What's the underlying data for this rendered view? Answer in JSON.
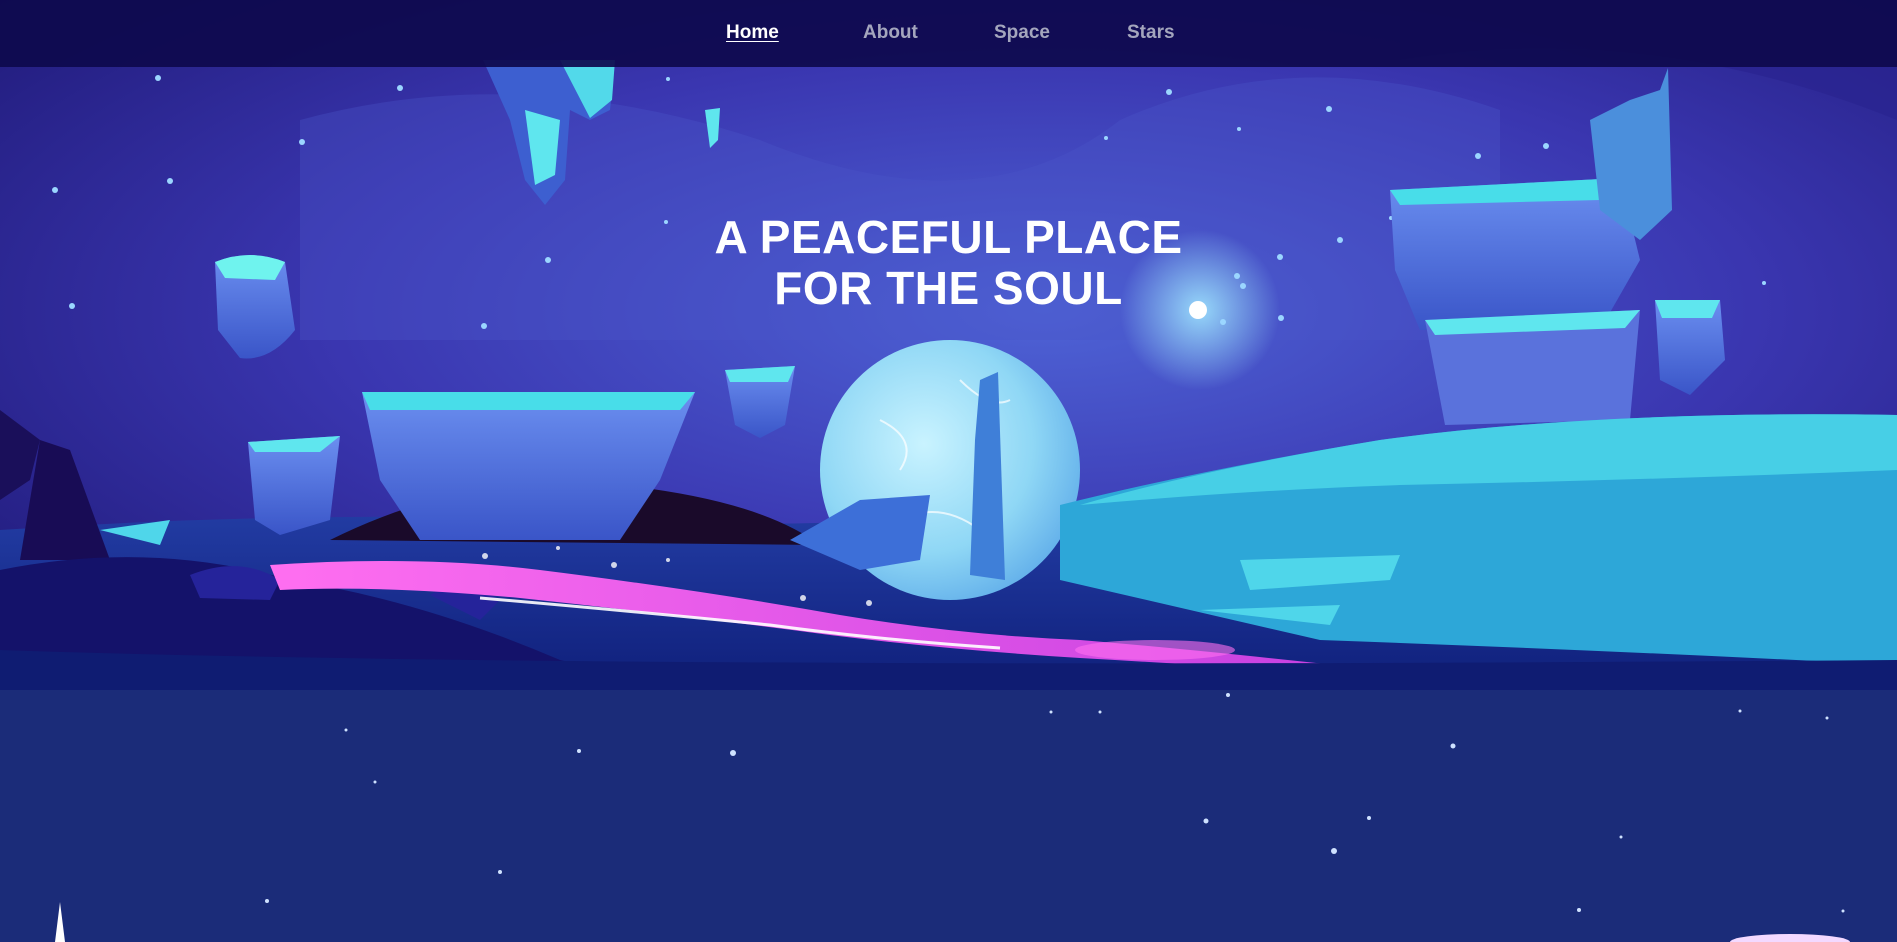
{
  "nav": {
    "items": [
      {
        "label": "Home",
        "active": true
      },
      {
        "label": "About",
        "active": false
      },
      {
        "label": "Space",
        "active": false
      },
      {
        "label": "Stars",
        "active": false
      }
    ]
  },
  "hero": {
    "title_line1": "A PEACEFUL PLACE",
    "title_line2": "FOR THE SOUL"
  },
  "colors": {
    "nav_bg": "#0e0a4e",
    "sky": "#3a3fb8",
    "ice": "#3fd6e8",
    "glow": "#ff5ce8",
    "lower_bg": "#1b2c79"
  }
}
